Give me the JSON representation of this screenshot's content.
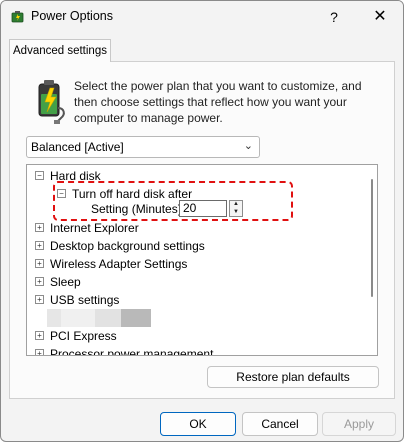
{
  "window": {
    "title": "Power Options",
    "help_glyph": "?",
    "close_glyph": "✕"
  },
  "tab": {
    "label": "Advanced settings"
  },
  "description": "Select the power plan that you want to customize, and then choose settings that reflect how you want your computer to manage power.",
  "plan_select": {
    "value": "Balanced [Active]",
    "chevron": "⌄"
  },
  "tree": {
    "hard_disk": "Hard disk",
    "turn_off_after": "Turn off hard disk after",
    "setting_label": "Setting (Minutes):",
    "setting_value": "20",
    "internet_explorer": "Internet Explorer",
    "desktop_background": "Desktop background settings",
    "wireless_adapter": "Wireless Adapter Settings",
    "sleep": "Sleep",
    "usb_settings": "USB settings",
    "pci_express": "PCI Express",
    "processor_power": "Processor power management"
  },
  "glyphs": {
    "collapse": "−",
    "expand": "+",
    "spin_up": "▲",
    "spin_down": "▼"
  },
  "buttons": {
    "restore": "Restore plan defaults",
    "ok": "OK",
    "cancel": "Cancel",
    "apply": "Apply"
  },
  "colors": {
    "highlight": "#e01010",
    "ok_border": "#0067c0"
  }
}
